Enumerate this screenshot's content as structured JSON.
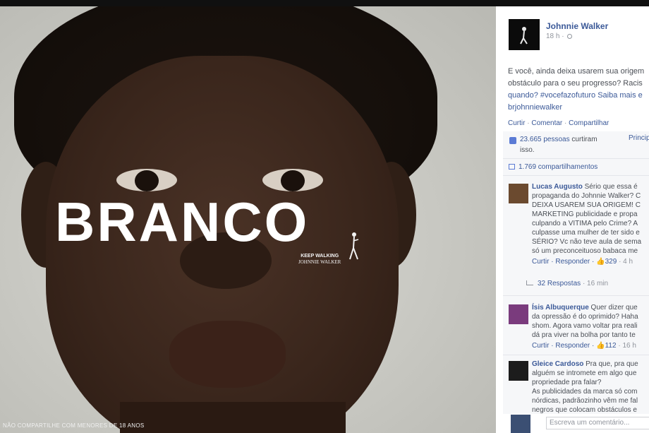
{
  "ad": {
    "headline": "BRANCO",
    "tagline_line1": "KEEP WALKING",
    "tagline_line2": "JOHNNIE WALKER",
    "disclaimer": "NÃO COMPARTILHE COM MENORES DE 18 ANOS"
  },
  "post": {
    "page_name": "Johnnie Walker",
    "time": "18 h ·",
    "text_lines": [
      "E você, ainda deixa usarem sua origem",
      "obstáculo para o seu progresso? Racis",
      "quando? #vocefazofuturo Saiba mais e"
    ],
    "link": "brjohnniewalker",
    "actions": [
      "Curtir",
      "Comentar",
      "Compartilhar"
    ],
    "likes_count": "23.665 pessoas",
    "likes_suffix": "curtiram",
    "likes_line2": "isso.",
    "popular_label": "Princip",
    "shares": "1.769 compartilhamentos"
  },
  "comments": [
    {
      "author": "Lucas Augusto",
      "first": "Sério que essa é",
      "lines": [
        "propaganda do Johnnie Walker? C",
        "DEIXA USAREM SUA ORIGEM! C",
        "MARKETING publicidade e propa",
        "culpando a VITIMA pelo Crime? A",
        "culpasse uma mulher de ter sido e",
        "SÉRIO? Vc não teve aula de sema",
        "só um preconceituoso babaca me"
      ],
      "meta_like": "Curtir",
      "meta_reply": "Responder",
      "meta_count": "329",
      "meta_time": "· 4 h",
      "replies": "32 Respostas",
      "replies_time": "· 16 min"
    },
    {
      "author": "Ísis Albuquerque",
      "first": "Quer dizer que",
      "lines": [
        "da opressão é do oprimido? Haha",
        "shom. Agora vamo voltar pra reali",
        "dá pra viver na bolha por tanto te"
      ],
      "meta_like": "Curtir",
      "meta_reply": "Responder",
      "meta_count": "112",
      "meta_time": "· 16 h"
    },
    {
      "author": "Gleice Cardoso",
      "first": "Pra que, pra que",
      "lines": [
        "alguém se intromete em algo que",
        "propriedade pra falar?",
        "As publicidades da marca só com",
        "nórdicas, padrãozinho vêm me fal",
        "negros que colocam obstáculos e"
      ]
    }
  ],
  "composer": {
    "placeholder": "Escreva um comentário..."
  },
  "colors": {
    "link": "#3b5998",
    "text": "#4b4f56",
    "muted": "#90949c"
  },
  "icons": [
    "striding-man-logo",
    "globe-icon",
    "thumb-up-icon",
    "share-icon",
    "reply-arrow-icon"
  ]
}
